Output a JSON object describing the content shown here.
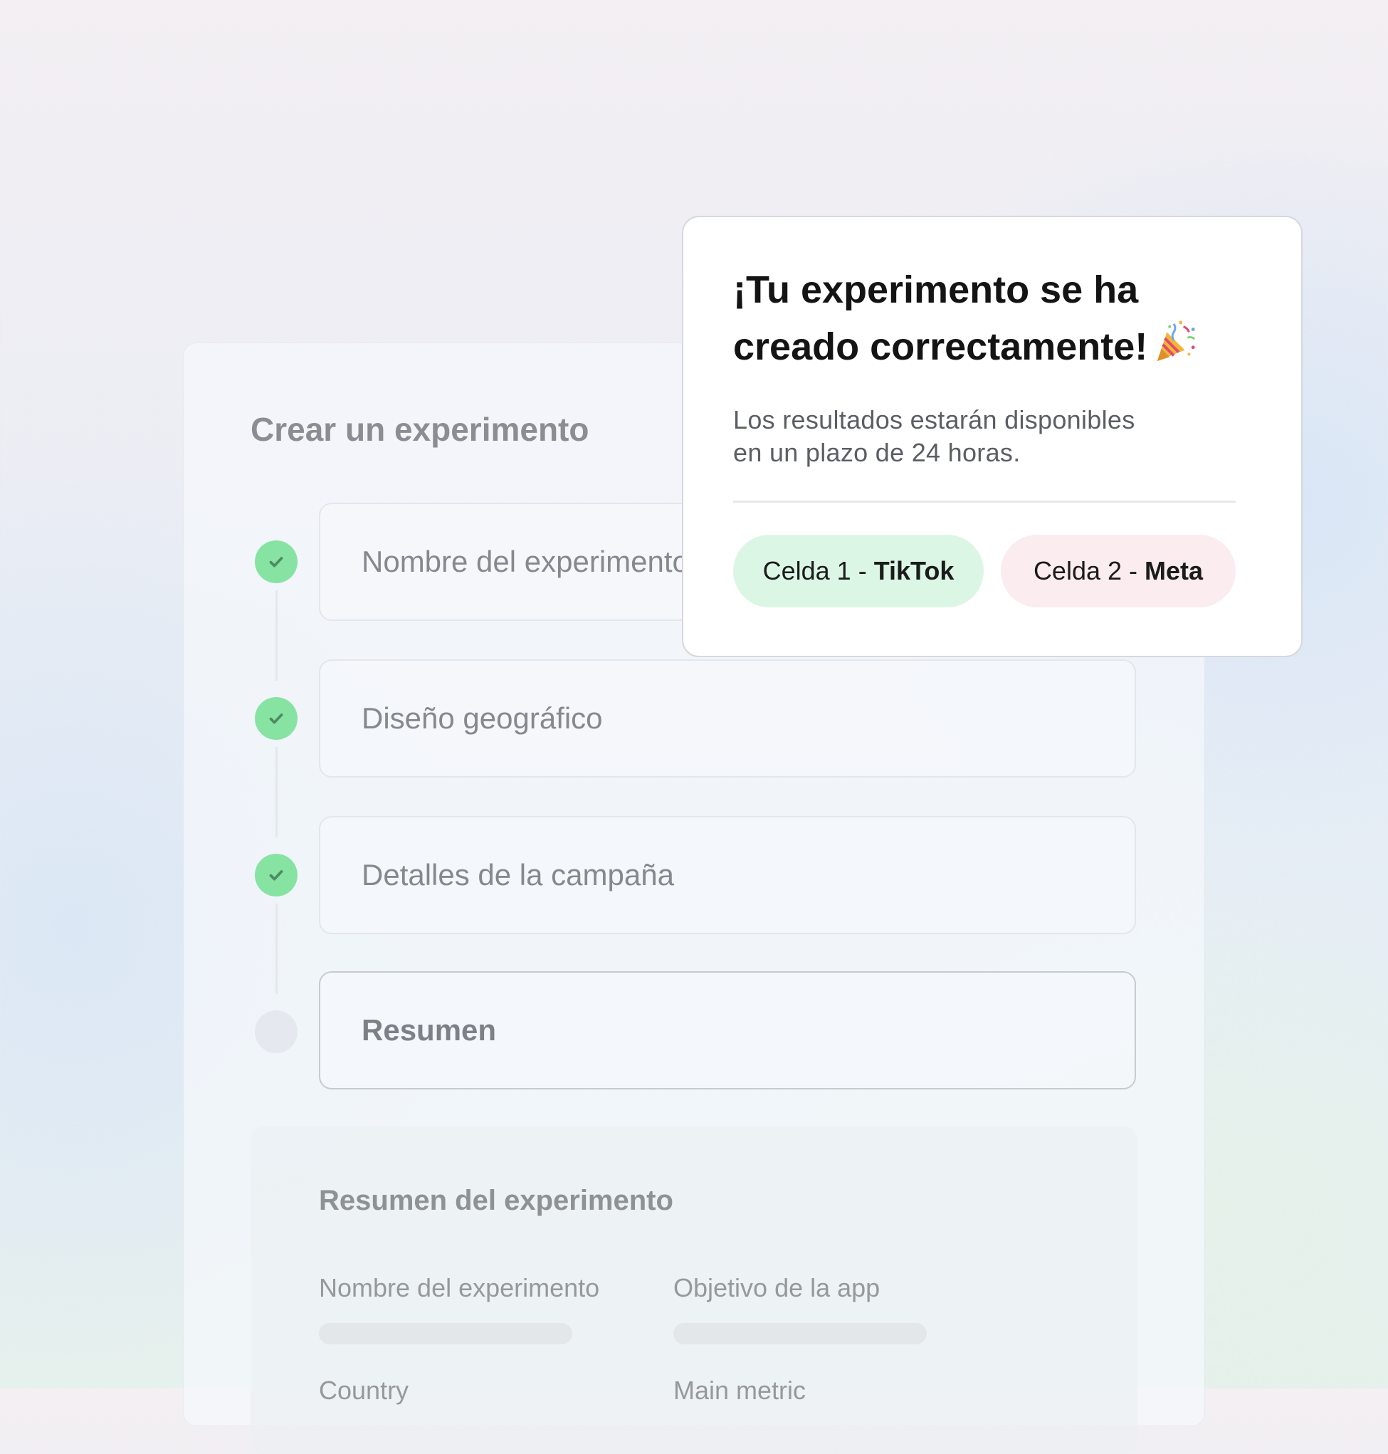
{
  "experiment_form": {
    "title": "Crear un experimento",
    "steps": [
      {
        "label": "Nombre del experimento",
        "status": "completed"
      },
      {
        "label": "Diseño geográfico",
        "status": "completed"
      },
      {
        "label": "Detalles de la campaña",
        "status": "completed"
      },
      {
        "label": "Resumen",
        "status": "current"
      }
    ],
    "summary": {
      "title": "Resumen del experimento",
      "fields": [
        {
          "label": "Nombre del experimento"
        },
        {
          "label": "Objetivo de la app"
        },
        {
          "label": "Country"
        },
        {
          "label": "Main metric"
        }
      ]
    }
  },
  "success_modal": {
    "title_line1": "¡Tu experimento se ha",
    "title_line2": "creado correctamente!",
    "title_icon": "party-popper-icon",
    "description_line1": "Los resultados estarán disponibles",
    "description_line2": "en un plazo de 24 horas.",
    "cells": [
      {
        "prefix": "Celda 1 - ",
        "platform": "TikTok",
        "color": "#dcf6e6"
      },
      {
        "prefix": "Celda 2 - ",
        "platform": "Meta",
        "color": "#fbecf0"
      }
    ]
  },
  "colors": {
    "step_complete": "#86e3a2",
    "step_pending": "#e5e8ee",
    "checkmark": "#4f8a63"
  }
}
